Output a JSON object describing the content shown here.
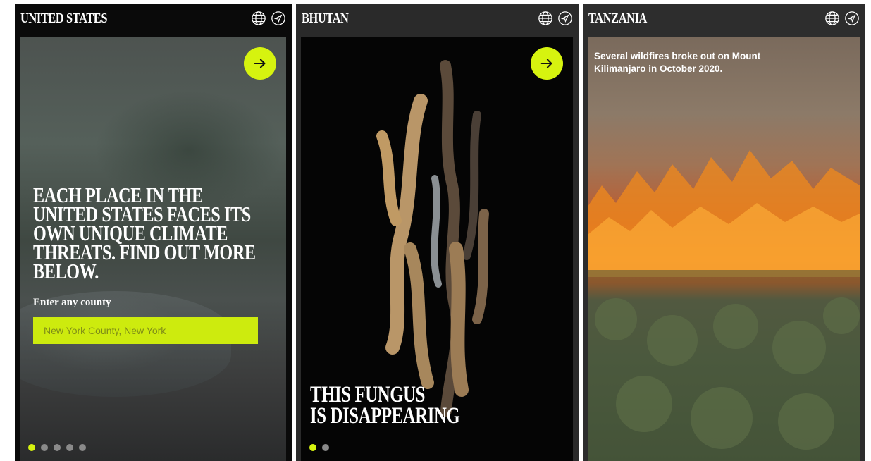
{
  "panels": [
    {
      "country": "UNITED STATES",
      "headline": "EACH PLACE IN THE UNITED STATES FACES ITS OWN UNIQUE CLIMATE THREATS. FIND OUT MORE BELOW.",
      "county_label": "Enter any county",
      "county_placeholder": "New York County, New York",
      "dots_total": 5,
      "dots_active": 1
    },
    {
      "country": "BHUTAN",
      "title_line1": "THIS FUNGUS",
      "title_line2": "IS DISAPPEARING",
      "dots_total": 2,
      "dots_active": 1
    },
    {
      "country": "TANZANIA",
      "caption": "Several wildfires broke out on Mount Kilimanjaro in October 2020."
    }
  ],
  "icons": {
    "globe": "globe-icon",
    "share": "navigation-arrow-icon",
    "arrow": "arrow-right-icon"
  },
  "colors": {
    "accent": "#d6f30f",
    "dot_inactive": "#8a8a8a"
  }
}
